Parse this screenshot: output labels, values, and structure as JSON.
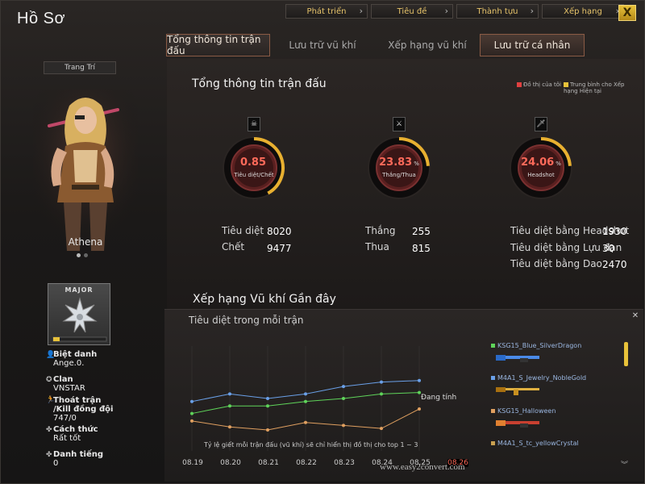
{
  "window": {
    "title": "Hồ Sơ",
    "close_label": "X"
  },
  "top_nav": [
    {
      "label": "Phát triển"
    },
    {
      "label": "Tiêu đề"
    },
    {
      "label": "Thành tựu"
    },
    {
      "label": "Xếp hạng"
    }
  ],
  "tabs": [
    {
      "label": "Tổng thông tin trận đấu"
    },
    {
      "label": "Lưu trữ vũ khí"
    },
    {
      "label": "Xếp hạng vũ khí"
    },
    {
      "label": "Lưu trữ cá nhân"
    }
  ],
  "left": {
    "decor_button": "Trang Trí",
    "character_name": "Athena",
    "rank_label": "MAJOR",
    "info": [
      {
        "label": "Biệt danh",
        "value": "Ange.0."
      },
      {
        "label": "Clan",
        "value": "VNSTAR"
      },
      {
        "label": "Thoát trận\n/Kill đồng đội",
        "value": "747/0"
      },
      {
        "label": "Cách thức",
        "value": "Rất tốt"
      },
      {
        "label": "Danh tiếng",
        "value": "0"
      }
    ]
  },
  "overview": {
    "title": "Tổng thông tin trận đấu",
    "legend": [
      {
        "label": "Đồ thị của tôi",
        "color": "#e04040"
      },
      {
        "label": "Trung bình cho Xếp hạng Hiện tại",
        "color": "#e8c23a"
      }
    ],
    "gauges": [
      {
        "value": "0.85",
        "unit": "",
        "caption": "Tiêu diệt/Chết",
        "icon": "skull-icon",
        "fill": 0.42
      },
      {
        "value": "23.83",
        "unit": "%",
        "caption": "Thắng/Thua",
        "icon": "swords-icon",
        "fill": 0.24
      },
      {
        "value": "24.06",
        "unit": "%",
        "caption": "Headshot",
        "icon": "knife-icon",
        "fill": 0.24
      }
    ],
    "stats": {
      "kills_label": "Tiêu diệt",
      "kills": "8020",
      "deaths_label": "Chết",
      "deaths": "9477",
      "wins_label": "Thắng",
      "wins": "255",
      "losses_label": "Thua",
      "losses": "815",
      "hs_label": "Tiêu diệt bằng Headshot",
      "hs": "1930",
      "grenade_label": "Tiêu diệt bằng Lựu đạn",
      "grenade": "30",
      "knife_label": "Tiêu diệt bằng Dao",
      "knife": "2470"
    }
  },
  "recent": {
    "title": "Xếp hạng Vũ khí Gần đây",
    "subtitle": "Tiêu diệt trong mỗi trận",
    "close_label": "✕",
    "note": "Tỷ lệ giết mỗi trận đấu (vũ khí) sẽ chỉ hiển thị đồ thị cho top 1 ~ 3",
    "in_progress": "Đang tính",
    "watermark": "www.easy2convert.com",
    "weapons": [
      {
        "name": "KSG15_Blue_SilverDragon",
        "color": "#5fd45a"
      },
      {
        "name": "M4A1_S_Jewelry_NobleGold",
        "color": "#6aa0e8"
      },
      {
        "name": "KSG15_Halloween",
        "color": "#e0a060"
      },
      {
        "name": "M4A1_S_tc_yellowCrystal",
        "color": "#c8a050"
      }
    ]
  },
  "chart_data": {
    "type": "line",
    "categories": [
      "08.19",
      "08.20",
      "08.21",
      "08.22",
      "08.23",
      "08.24",
      "08.25",
      "08.26"
    ],
    "series": [
      {
        "name": "KSG15_Blue_SilverDragon",
        "color": "#5fd45a",
        "values": [
          2.5,
          3.0,
          3.0,
          3.3,
          3.5,
          3.8,
          3.9,
          null
        ]
      },
      {
        "name": "M4A1_S_Jewelry_NobleGold",
        "color": "#6aa0e8",
        "values": [
          3.3,
          3.8,
          3.5,
          3.8,
          4.3,
          4.6,
          4.7,
          null
        ]
      },
      {
        "name": "KSG15_Halloween",
        "color": "#e0a060",
        "values": [
          2.0,
          1.6,
          1.4,
          1.9,
          1.7,
          1.5,
          2.8,
          null
        ]
      }
    ],
    "ylim": [
      0,
      7
    ],
    "highlight_category": "08.26"
  }
}
